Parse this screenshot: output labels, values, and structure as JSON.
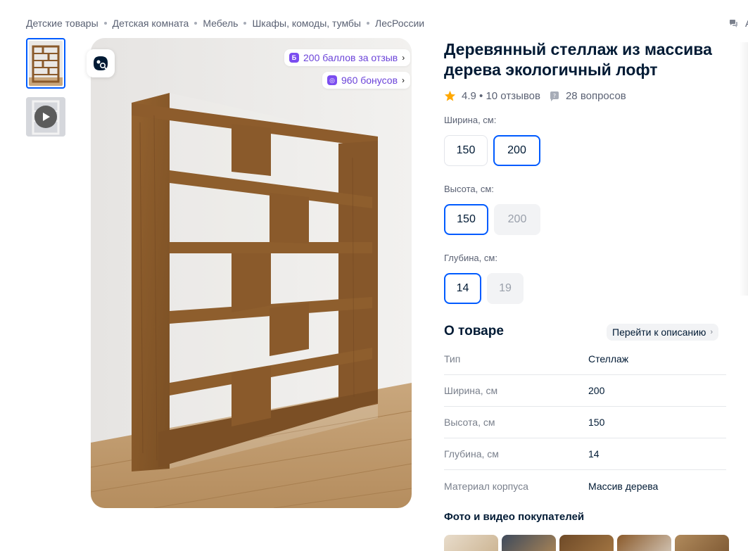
{
  "breadcrumbs": [
    "Детские товары",
    "Детская комната",
    "Мебель",
    "Шкафы, комоды, тумбы",
    "ЛесРоссии"
  ],
  "top_right_text": "А",
  "promos": {
    "review_points": "200 баллов за отзыв",
    "bonuses": "960 бонусов"
  },
  "product": {
    "title": "Деревянный стеллаж из массива дерева экологичный лофт",
    "rating": "4.9",
    "reviews": "10 отзывов",
    "questions": "28 вопросов"
  },
  "options": {
    "width": {
      "label": "Ширина, см:",
      "values": [
        "150",
        "200"
      ],
      "selected": "200"
    },
    "height": {
      "label": "Высота, см:",
      "values": [
        "150",
        "200"
      ],
      "selected": "150"
    },
    "depth": {
      "label": "Глубина, см:",
      "values": [
        "14",
        "19"
      ],
      "selected": "14"
    }
  },
  "about": {
    "title": "О товаре",
    "link": "Перейти к описанию",
    "specs": [
      {
        "key": "Тип",
        "value": "Стеллаж"
      },
      {
        "key": "Ширина, см",
        "value": "200"
      },
      {
        "key": "Высота, см",
        "value": "150"
      },
      {
        "key": "Глубина, см",
        "value": "14"
      },
      {
        "key": "Материал корпуса",
        "value": "Массив дерева"
      }
    ]
  },
  "ugc": {
    "title": "Фото и видео покупателей"
  },
  "colors": {
    "accent": "#005bff",
    "promo": "#6b43d9",
    "star": "#ffa800",
    "wood": "#8a5a2b"
  }
}
